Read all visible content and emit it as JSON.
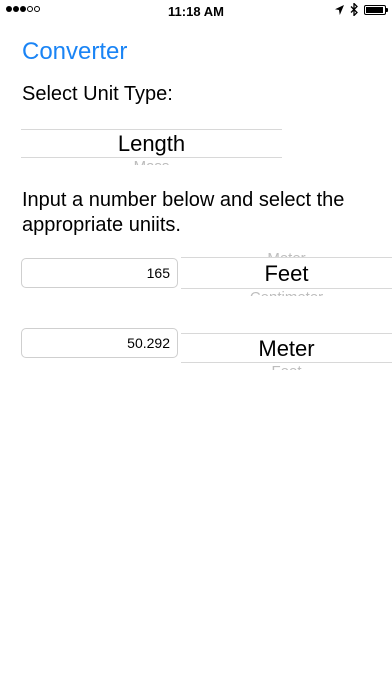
{
  "status_bar": {
    "time": "11:18 AM",
    "signal_dots_filled": 3,
    "signal_dots_total": 5,
    "battery_level": 0.95
  },
  "nav": {
    "title": "Converter"
  },
  "unit_type": {
    "label": "Select Unit Type:",
    "selected": "Length",
    "below": "Mass"
  },
  "instruction": "Input a number below and select the appropriate uniits.",
  "input": {
    "value": "165",
    "unit_above": "Meter",
    "unit": "Feet",
    "unit_below": "Centimeter"
  },
  "output": {
    "value": "50.292",
    "unit": "Meter",
    "unit_below": "Feet"
  },
  "colors": {
    "accent": "#1a84f5",
    "ghost_text": "#bdbdbd",
    "divider": "#d8d8d8"
  }
}
